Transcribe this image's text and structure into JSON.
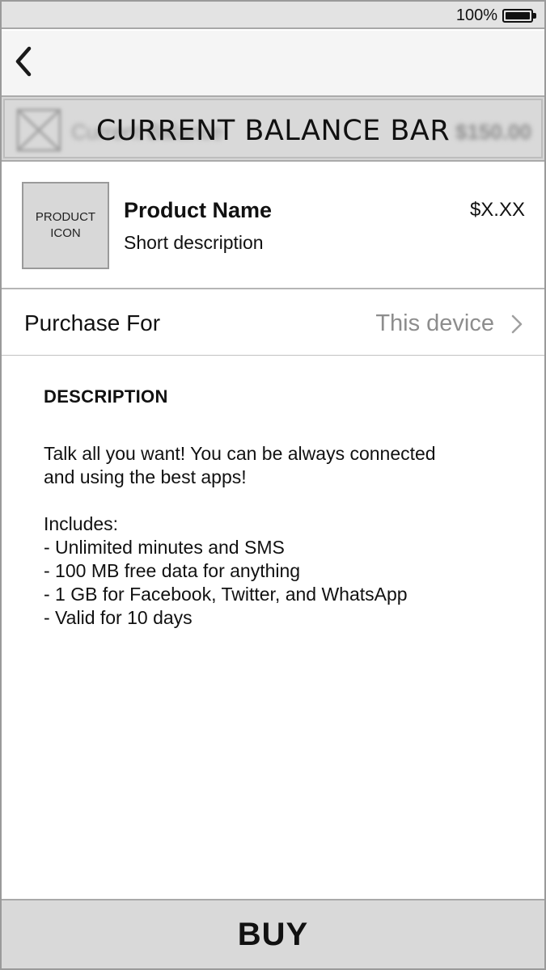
{
  "status_bar": {
    "battery_percent": "100%",
    "battery_icon": "battery-full-icon"
  },
  "nav": {
    "back_icon": "chevron-left-icon"
  },
  "balance_bar": {
    "overlay_label": "CURRENT BALANCE BAR",
    "blurred_label": "Current Balance",
    "blurred_amount": "$150.00",
    "icon": "image-placeholder-icon"
  },
  "product": {
    "icon_label_line1": "PRODUCT",
    "icon_label_line2": "ICON",
    "name": "Product Name",
    "short_description": "Short description",
    "price": "$X.XX"
  },
  "purchase_for": {
    "label": "Purchase For",
    "value": "This device",
    "icon": "chevron-right-icon"
  },
  "description": {
    "heading": "DESCRIPTION",
    "intro_line1": "Talk all you want! You can be always connected",
    "intro_line2": "and using the best apps!",
    "includes_label": "Includes:",
    "items": [
      "- Unlimited minutes and SMS",
      "- 100 MB free data for anything",
      "- 1 GB for Facebook, Twitter, and WhatsApp",
      "- Valid for 10 days"
    ]
  },
  "buy_button": {
    "label": "BUY"
  }
}
